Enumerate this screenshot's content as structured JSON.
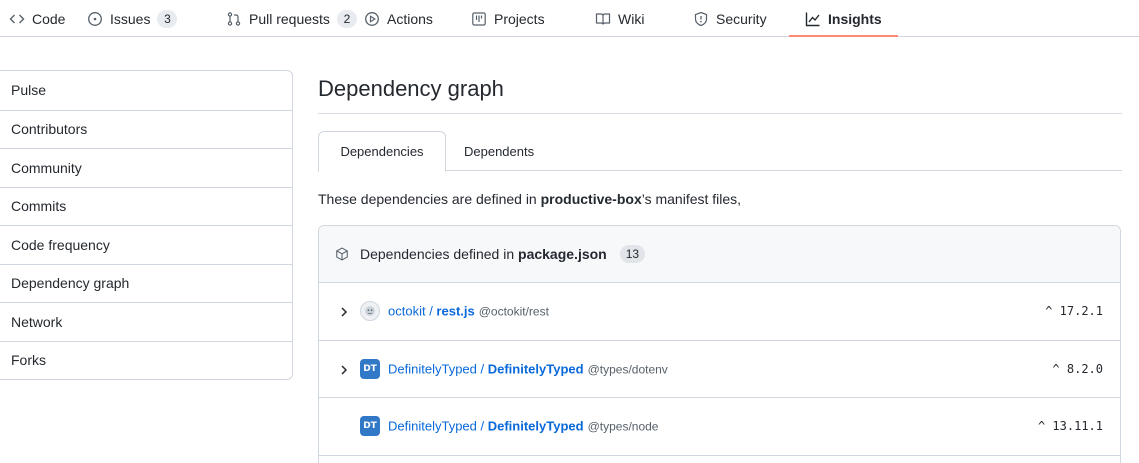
{
  "nav": {
    "tabs": [
      {
        "label": "Code",
        "icon": "code-icon"
      },
      {
        "label": "Issues",
        "icon": "issue-opened-icon",
        "count": "3"
      },
      {
        "label": "Pull requests",
        "icon": "git-pull-request-icon",
        "count": "2"
      },
      {
        "label": "Actions",
        "icon": "play-icon"
      },
      {
        "label": "Projects",
        "icon": "table-icon"
      },
      {
        "label": "Wiki",
        "icon": "book-icon"
      },
      {
        "label": "Security",
        "icon": "shield-icon"
      },
      {
        "label": "Insights",
        "icon": "graph-icon",
        "selected": true
      }
    ],
    "selected_underline_color": "#fd8c73"
  },
  "sidebar": {
    "items": [
      {
        "label": "Pulse"
      },
      {
        "label": "Contributors"
      },
      {
        "label": "Community"
      },
      {
        "label": "Commits"
      },
      {
        "label": "Code frequency"
      },
      {
        "label": "Dependency graph"
      },
      {
        "label": "Network"
      },
      {
        "label": "Forks"
      }
    ]
  },
  "main": {
    "title": "Dependency graph",
    "subtabs": [
      {
        "label": "Dependencies",
        "active": true
      },
      {
        "label": "Dependents",
        "active": false
      }
    ],
    "description": {
      "prefix": "These dependencies are defined in ",
      "repo": "productive-box",
      "suffix": "’s manifest files,"
    },
    "manifest": {
      "prefix": "Dependencies defined in ",
      "file": "package.json",
      "count": "13",
      "icon": "package-icon"
    },
    "dependencies": [
      {
        "owner": "octokit",
        "repo": "rest.js",
        "package": "@octokit/rest",
        "version": "^ 17.2.1",
        "expandable": true,
        "avatar": "octocat-avatar"
      },
      {
        "owner": "DefinitelyTyped",
        "repo": "DefinitelyTyped",
        "package": "@types/dotenv",
        "version": "^ 8.2.0",
        "expandable": true,
        "avatar": "DT"
      },
      {
        "owner": "DefinitelyTyped",
        "repo": "DefinitelyTyped",
        "package": "@types/node",
        "version": "^ 13.11.1",
        "expandable": false,
        "avatar": "DT"
      }
    ],
    "link_color": "#0969da"
  }
}
